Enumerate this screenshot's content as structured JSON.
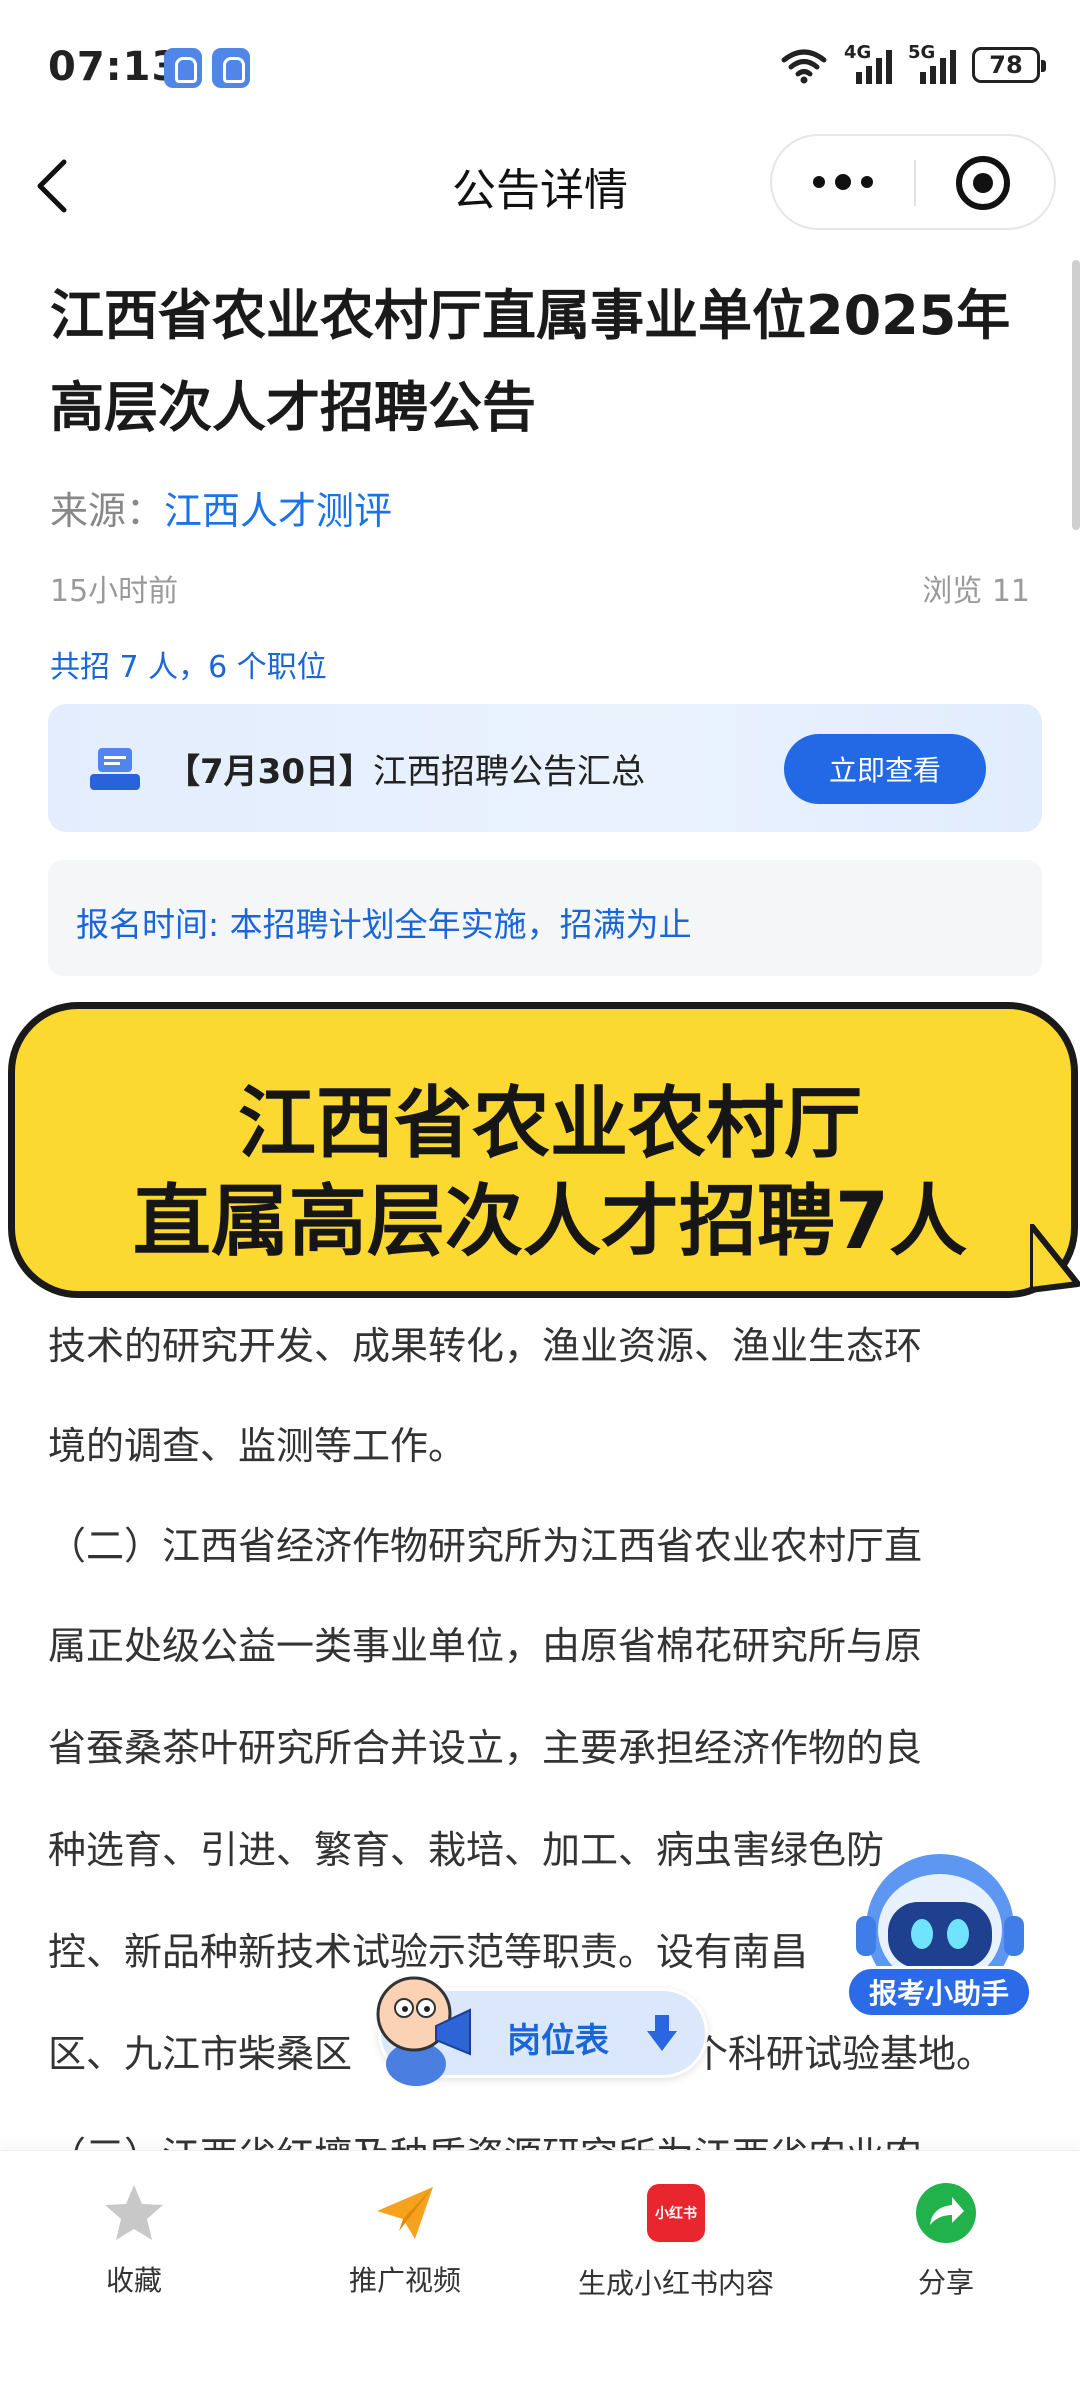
{
  "status": {
    "time": "07:13",
    "net1": "4G",
    "net2": "5G",
    "battery": "78"
  },
  "nav": {
    "title": "公告详情"
  },
  "article": {
    "title": "江西省农业农村厅直属事业单位2025年高层次人才招聘公告",
    "source_label": "来源：",
    "source_name": "江西人才测评",
    "time": "15小时前",
    "views": "浏览 11",
    "summary": "共招 7 人，6 个职位"
  },
  "banner": {
    "date": "【7月30日】",
    "text": "江西招聘公告汇总",
    "button": "立即查看"
  },
  "registration": {
    "text": "报名时间: 本招聘计划全年实施，招满为止"
  },
  "overlay": {
    "line1": "江西省农业农村厅",
    "line2": "直属高层次人才招聘7人"
  },
  "body": {
    "lines": [
      "技术的研究开发、成果转化，渔业资源、渔业生态环",
      "境的调查、监测等工作。",
      "（二）江西省经济作物研究所为江西省农业农村厅直",
      "属正处级公益一类事业单位，由原省棉花研究所与原",
      "省蚕桑茶叶研究所合并设立，主要承担经济作物的良",
      "种选育、引进、繁育、栽培、加工、病虫害绿色防",
      "控、新品种新技术试验示范等职责。设有南昌",
      "区、九江市柴桑区",
      "个科研试验基地。",
      "（三）江西省红壤及种质资源研究所为江西省农业农"
    ]
  },
  "helper": {
    "label": "报考小助手"
  },
  "jobs": {
    "label": "岗位表"
  },
  "bottom_bar": {
    "tabs": [
      {
        "label": "收藏",
        "icon": "star-icon"
      },
      {
        "label": "推广视频",
        "icon": "paper-plane-icon"
      },
      {
        "label": "生成小红书内容",
        "icon": "xiaohongshu-icon",
        "badge": "小红书"
      },
      {
        "label": "分享",
        "icon": "share-icon"
      }
    ]
  }
}
